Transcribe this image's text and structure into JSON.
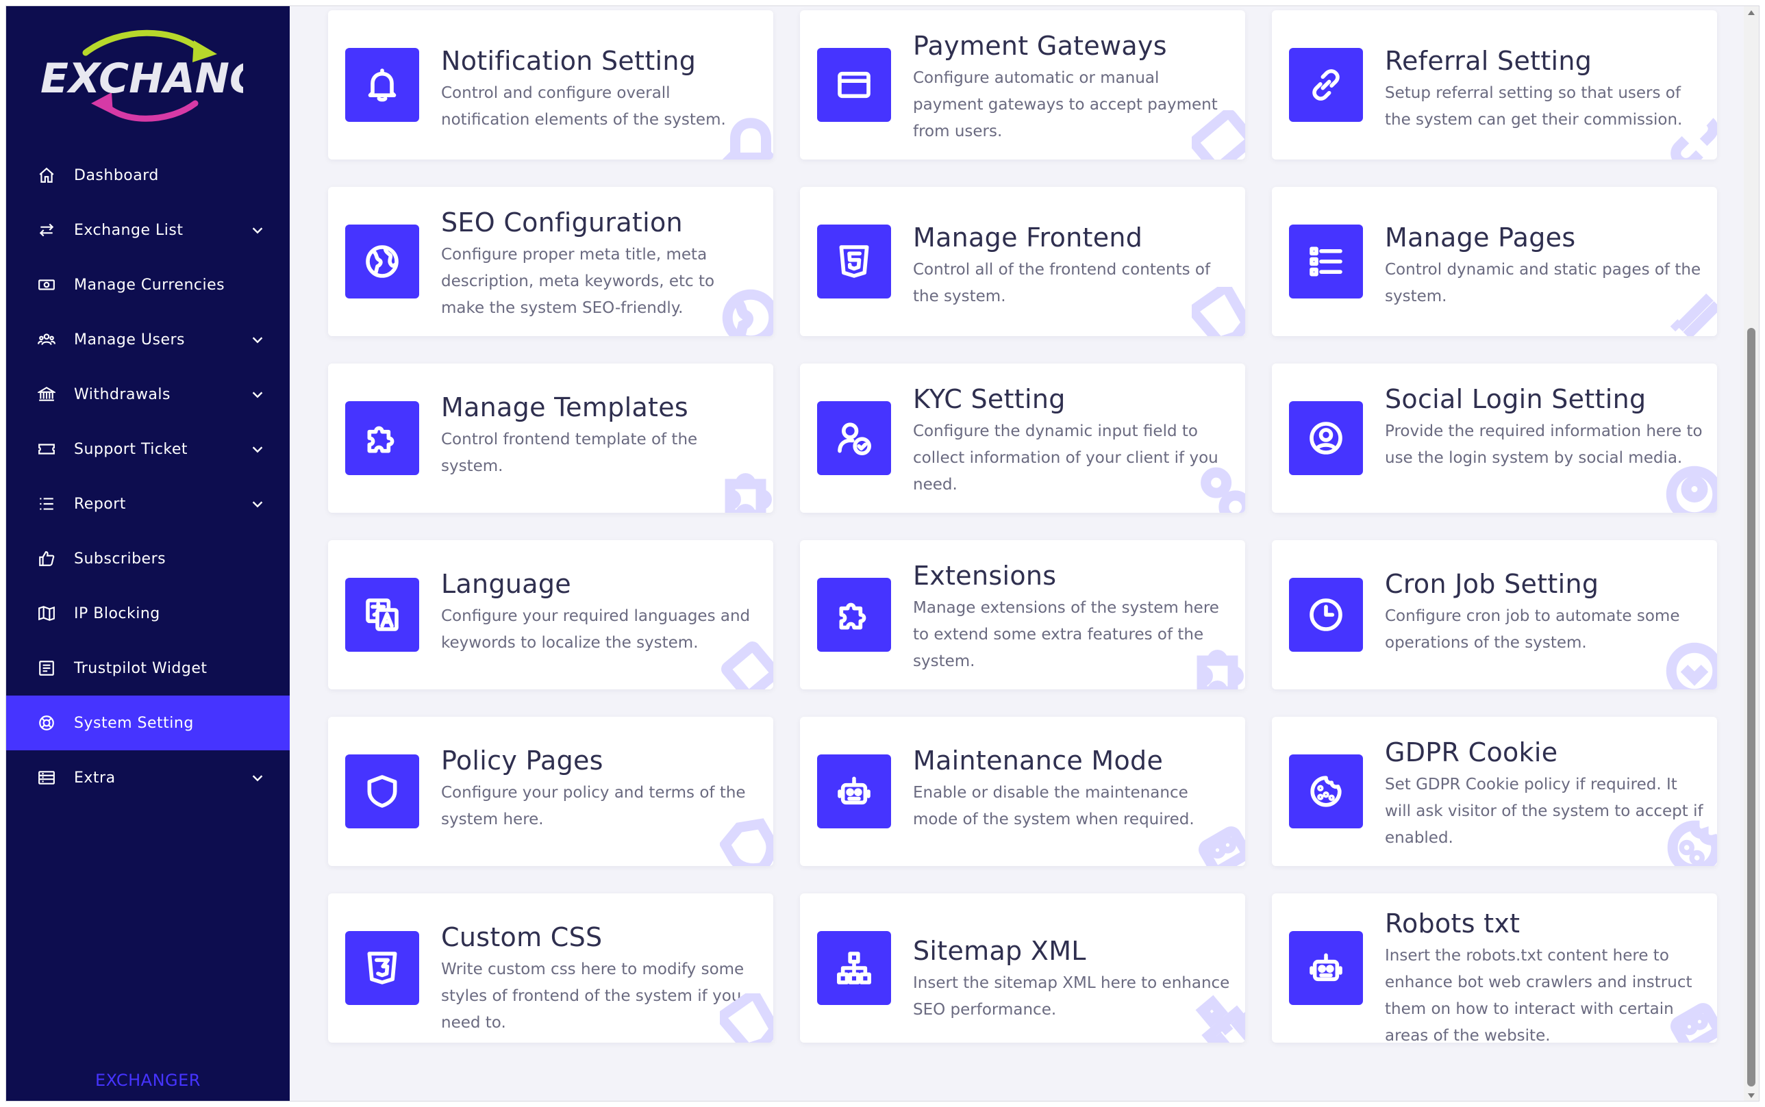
{
  "brand": {
    "logo_text": "EXCHANGE",
    "footer_text": "EXCHANGER",
    "accent_color": "#4634ff",
    "sidebar_color": "#0d0d4f"
  },
  "sidebar": {
    "items": [
      {
        "label": "Dashboard",
        "icon": "home-icon",
        "has_submenu": false,
        "active": false
      },
      {
        "label": "Exchange List",
        "icon": "exchange-icon",
        "has_submenu": true,
        "active": false
      },
      {
        "label": "Manage Currencies",
        "icon": "money-icon",
        "has_submenu": false,
        "active": false
      },
      {
        "label": "Manage Users",
        "icon": "users-icon",
        "has_submenu": true,
        "active": false
      },
      {
        "label": "Withdrawals",
        "icon": "bank-icon",
        "has_submenu": true,
        "active": false
      },
      {
        "label": "Support Ticket",
        "icon": "ticket-icon",
        "has_submenu": true,
        "active": false
      },
      {
        "label": "Report",
        "icon": "list-icon",
        "has_submenu": true,
        "active": false
      },
      {
        "label": "Subscribers",
        "icon": "thumbs-up-icon",
        "has_submenu": false,
        "active": false
      },
      {
        "label": "IP Blocking",
        "icon": "map-icon",
        "has_submenu": false,
        "active": false
      },
      {
        "label": "Trustpilot Widget",
        "icon": "widget-icon",
        "has_submenu": false,
        "active": false
      },
      {
        "label": "System Setting",
        "icon": "life-ring-icon",
        "has_submenu": false,
        "active": true
      },
      {
        "label": "Extra",
        "icon": "server-icon",
        "has_submenu": true,
        "active": false
      }
    ]
  },
  "cards": [
    {
      "title": "Notification Setting",
      "desc": "Control and configure overall notification elements of the system.",
      "icon": "bell-icon"
    },
    {
      "title": "Payment Gateways",
      "desc": "Configure automatic or manual payment gateways to accept payment from users.",
      "icon": "credit-card-icon"
    },
    {
      "title": "Referral Setting",
      "desc": "Setup referral setting so that users of the system can get their commission.",
      "icon": "link-icon"
    },
    {
      "title": "SEO Configuration",
      "desc": "Configure proper meta title, meta description, meta keywords, etc to make the system SEO-friendly.",
      "icon": "globe-icon"
    },
    {
      "title": "Manage Frontend",
      "desc": "Control all of the frontend contents of the system.",
      "icon": "html5-icon"
    },
    {
      "title": "Manage Pages",
      "desc": "Control dynamic and static pages of the system.",
      "icon": "list-details-icon"
    },
    {
      "title": "Manage Templates",
      "desc": "Control frontend template of the system.",
      "icon": "puzzle-icon"
    },
    {
      "title": "KYC Setting",
      "desc": "Configure the dynamic input field to collect information of your client if you need.",
      "icon": "user-check-icon"
    },
    {
      "title": "Social Login Setting",
      "desc": "Provide the required information here to use the login system by social media.",
      "icon": "user-circle-icon"
    },
    {
      "title": "Language",
      "desc": "Configure your required languages and keywords to localize the system.",
      "icon": "language-icon"
    },
    {
      "title": "Extensions",
      "desc": "Manage extensions of the system here to extend some extra features of the system.",
      "icon": "puzzle-icon"
    },
    {
      "title": "Cron Job Setting",
      "desc": "Configure cron job to automate some operations of the system.",
      "icon": "clock-icon"
    },
    {
      "title": "Policy Pages",
      "desc": "Configure your policy and terms of the system here.",
      "icon": "shield-icon"
    },
    {
      "title": "Maintenance Mode",
      "desc": "Enable or disable the maintenance mode of the system when required.",
      "icon": "robot-icon"
    },
    {
      "title": "GDPR Cookie",
      "desc": "Set GDPR Cookie policy if required. It will ask visitor of the system to accept if enabled.",
      "icon": "cookie-icon"
    },
    {
      "title": "Custom CSS",
      "desc": "Write custom css here to modify some styles of frontend of the system if you need to.",
      "icon": "css3-icon"
    },
    {
      "title": "Sitemap XML",
      "desc": "Insert the sitemap XML here to enhance SEO performance.",
      "icon": "sitemap-icon"
    },
    {
      "title": "Robots txt",
      "desc": "Insert the robots.txt content here to enhance bot web crawlers and instruct them on how to interact with certain areas of the website.",
      "icon": "robot-icon"
    }
  ]
}
